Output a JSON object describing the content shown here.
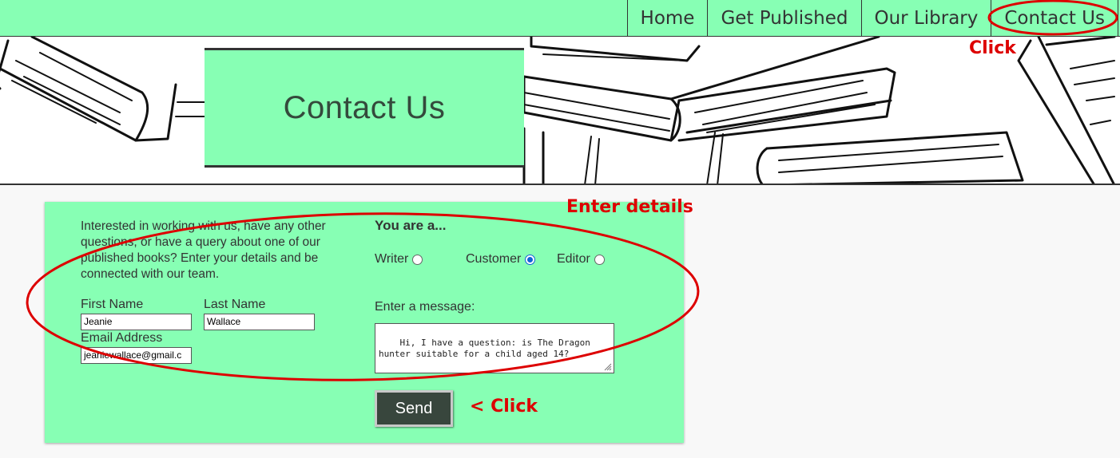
{
  "nav": {
    "items": [
      {
        "label": "Home"
      },
      {
        "label": "Get Published"
      },
      {
        "label": "Our Library"
      },
      {
        "label": "Contact Us"
      }
    ]
  },
  "hero": {
    "title": "Contact Us"
  },
  "form": {
    "intro": "Interested in working with us, have any other questions, or have a query about one of our published books? Enter your details and be connected with our team.",
    "first_name_label": "First Name",
    "first_name_value": "Jeanie",
    "last_name_label": "Last Name",
    "last_name_value": "Wallace",
    "email_label": "Email Address",
    "email_value": "jeaniewallace@gmail.c",
    "you_are_label": "You are a...",
    "roles": [
      {
        "label": "Writer",
        "checked": false
      },
      {
        "label": "Customer",
        "checked": true
      },
      {
        "label": "Editor",
        "checked": false
      }
    ],
    "message_label": "Enter a message:",
    "message_value": "Hi, I have a question: is The Dragon\nhunter suitable for a child aged 14?",
    "send_label": "Send"
  },
  "annotations": {
    "nav_click": "Click",
    "enter_details": "Enter details",
    "send_click": "< Click",
    "color": "#dd0000"
  },
  "colors": {
    "accent_green": "#87ffb4",
    "dark": "#333333",
    "button_bg": "#38463d",
    "radio_checked": "#0f62d6"
  }
}
